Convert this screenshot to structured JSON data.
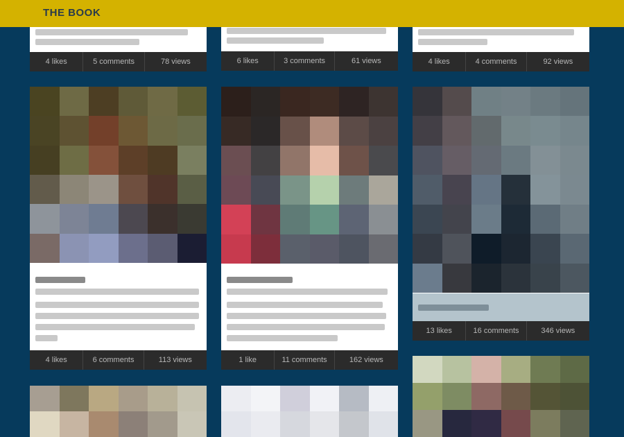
{
  "header": {
    "brand": "THE BOOK"
  },
  "cards": [
    {
      "likes": "4 likes",
      "comments": "5 comments",
      "views": "78 views"
    },
    {
      "likes": "6 likes",
      "comments": "3 comments",
      "views": "61 views"
    },
    {
      "likes": "4 likes",
      "comments": "4 comments",
      "views": "92 views"
    },
    {
      "likes": "4 likes",
      "comments": "6 comments",
      "views": "113 views"
    },
    {
      "likes": "1 like",
      "comments": "11 comments",
      "views": "162 views"
    },
    {
      "likes": "13 likes",
      "comments": "16 comments",
      "views": "346 views"
    }
  ],
  "colors": {
    "background": "#063a5c",
    "header": "#d4b200",
    "stats_bar": "#2b2b2b"
  },
  "mosaics": {
    "photo_a": [
      "#4a4421",
      "#6e6a45",
      "#4d3e23",
      "#5f5a38",
      "#6f6a45",
      "#5c5c33",
      "#4a4424",
      "#5e5232",
      "#73402a",
      "#6d5834",
      "#6d6a46",
      "#6a6d4c",
      "#463f22",
      "#6e6d45",
      "#84513a",
      "#5d3f28",
      "#4e3b23",
      "#7a7f60",
      "#625b4b",
      "#8c8677",
      "#9b9489",
      "#6f4f3f",
      "#50342a",
      "#5a5e45",
      "#8e949b",
      "#7d8496",
      "#6f7c92",
      "#4c4850",
      "#3b302c",
      "#3a3a32",
      "#7a6a66",
      "#8b93b3",
      "#929cc0",
      "#6c6f8c",
      "#5b5c72",
      "#1b1d33"
    ],
    "photo_b": [
      "#2c1f1b",
      "#2b2624",
      "#3a2720",
      "#3d2b23",
      "#2e2423",
      "#3d3431",
      "#372a25",
      "#2b2828",
      "#685149",
      "#b08c7c",
      "#5c4b47",
      "#4b4141",
      "#6b4e52",
      "#434143",
      "#917569",
      "#e6bca8",
      "#6e5249",
      "#4a4a4d",
      "#6d4a55",
      "#484a55",
      "#7a9488",
      "#b5d1ac",
      "#6d7b7b",
      "#aaa69b",
      "#d34156",
      "#6f3541",
      "#5f7b76",
      "#679585",
      "#5d6474",
      "#8a8f93",
      "#c73a4e",
      "#7d2e3b",
      "#5a606b",
      "#5a5b69",
      "#4e5460",
      "#6a6b71"
    ],
    "photo_c": [
      "#35343a",
      "#544b4c",
      "#708085",
      "#738187",
      "#6b7a80",
      "#65747b",
      "#433f46",
      "#63585c",
      "#626a6d",
      "#78888b",
      "#7a8b90",
      "#76868c",
      "#4f5360",
      "#665d65",
      "#646a73",
      "#6b7a81",
      "#839096",
      "#7b898f",
      "#505c69",
      "#48444f",
      "#657585",
      "#25303a",
      "#84939a",
      "#7b8990",
      "#3b4652",
      "#43444c",
      "#6b7c89",
      "#1d2a36",
      "#5b6a75",
      "#707e86",
      "#343a44",
      "#4f535b",
      "#0f1c29",
      "#1c2631",
      "#3a4550",
      "#5a6873",
      "#6b7c8d",
      "#38393e",
      "#1b242d",
      "#2b333b",
      "#39434b",
      "#4c5760"
    ],
    "photo_d": [
      "#a79e92",
      "#7e775d",
      "#b9a882",
      "#a89c8a",
      "#b8b199",
      "#c6c3b1",
      "#e0d8c2",
      "#c7b5a2",
      "#a98a6f",
      "#8c8078",
      "#a29a8c",
      "#c9c6b6"
    ],
    "photo_e": [
      "#ecedf2",
      "#f3f4f7",
      "#d0cfdb",
      "#f1f2f6",
      "#b6bbc4",
      "#eef0f4",
      "#e3e5ec",
      "#eaebf0",
      "#d6d8de",
      "#e5e6ea",
      "#c4c7cc",
      "#e0e3e9"
    ],
    "photo_f": [
      "#d2d8c0",
      "#b7c2a0",
      "#d4b2a8",
      "#a7ad82",
      "#6f7b53",
      "#5e6a46",
      "#94a06b",
      "#7e8c63",
      "#8e6964",
      "#6e5a48",
      "#545436",
      "#4d5236",
      "#999783",
      "#27283e",
      "#302a44",
      "#764a4c",
      "#7c7c5e",
      "#5f6450"
    ]
  }
}
